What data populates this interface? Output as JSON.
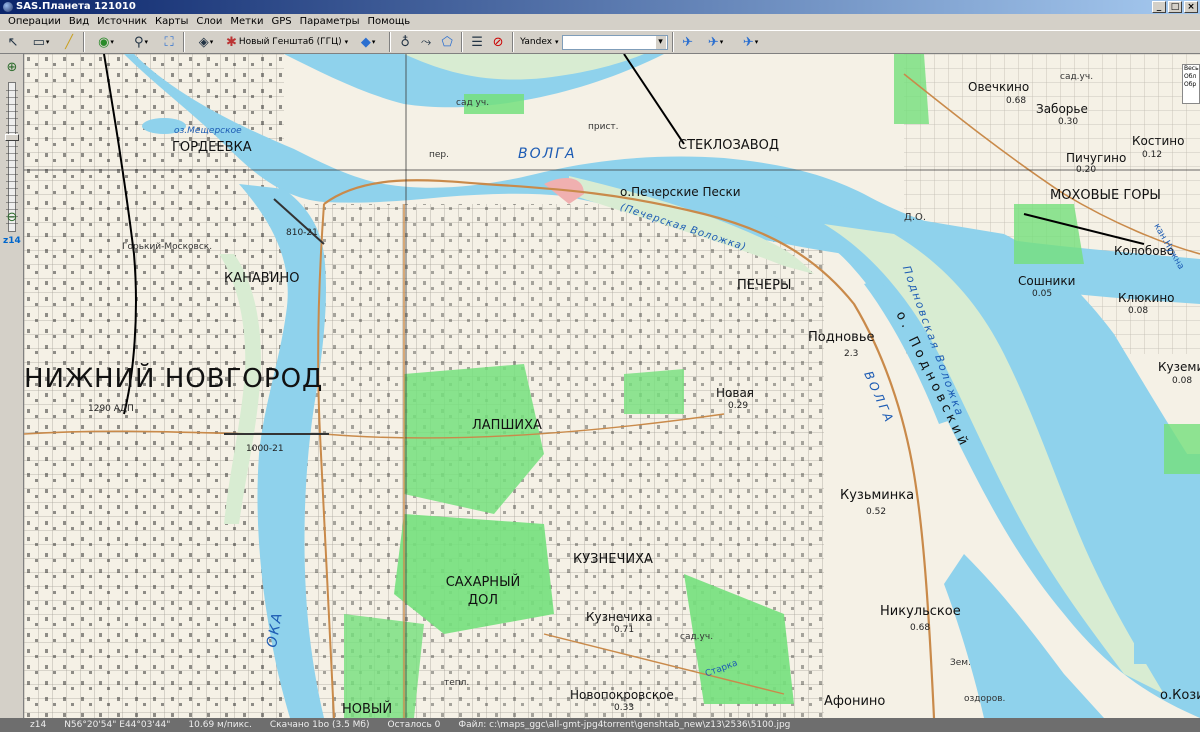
{
  "window": {
    "title": "SAS.Планета 121010"
  },
  "menu": [
    "Операции",
    "Вид",
    "Источник",
    "Карты",
    "Слои",
    "Метки",
    "GPS",
    "Параметры",
    "Помощь"
  ],
  "toolbar": {
    "map_source_label": "Новый Генштаб (ГГЦ)",
    "search_provider_label": "Yandex",
    "search_value": ""
  },
  "zoom": {
    "level_label": "z14"
  },
  "map": {
    "city_label": "НИЖНИЙ НОВГОРОД",
    "districts": [
      {
        "name": "ГОРДЕЕВКА"
      },
      {
        "name": "КАНАВИНО"
      },
      {
        "name": "ПЕЧЕРЫ"
      },
      {
        "name": "ЛАПШИХА"
      },
      {
        "name": "КУЗНЕЧИХА"
      },
      {
        "name": "САХАРНЫЙ ДОЛ"
      },
      {
        "name": "НОВЫЙ"
      },
      {
        "name": "СТЕКЛОЗАВОД"
      },
      {
        "name": "МОХОВЫЕ ГОРЫ"
      }
    ],
    "villages": [
      {
        "name": "Овечкино",
        "value": "0.68"
      },
      {
        "name": "Заборье",
        "value": "0.30"
      },
      {
        "name": "Костино",
        "value": "0.12"
      },
      {
        "name": "Пичугино",
        "value": "0.20"
      },
      {
        "name": "Колобово",
        "value": ""
      },
      {
        "name": "Сошники",
        "value": "0.05"
      },
      {
        "name": "Клюкино",
        "value": "0.08"
      },
      {
        "name": "Подновье",
        "value": "2.3"
      },
      {
        "name": "Новая",
        "value": "0.29"
      },
      {
        "name": "Кузьминка",
        "value": "0.52"
      },
      {
        "name": "Никульское",
        "value": "0.68"
      },
      {
        "name": "Кузнечиха",
        "value": "0.71"
      },
      {
        "name": "Новопокровское",
        "value": "0.33"
      },
      {
        "name": "Афонино",
        "value": ""
      },
      {
        "name": "Куземи",
        "value": "0.08"
      },
      {
        "name": "о.Кози",
        "value": ""
      }
    ],
    "rivers": [
      "ВОЛГА",
      "ВОЛГА",
      "ОКА"
    ],
    "islands": {
      "pecherskie": "о.Печерские Пески",
      "pecherskaya_volozhka": "(Печерская Воложка)",
      "podnovskaya_volozhka": "Подновская Воложка",
      "podnovskiy": "о. Подновский"
    },
    "annotations": {
      "lake": "оз.Мещерское",
      "bridge_1": "810-21",
      "bridge_2": "1000-21",
      "bridge_3": "1290 АДП",
      "kanavino_bridge": "Горький-Московск.",
      "ferry": "пер.",
      "pier": "прист.",
      "garden_1": "сад уч.",
      "garden_2": "сад.уч.",
      "garden_3": "сад.уч.",
      "kan_nuzhna": "кан.Нужна",
      "do_label": "Д.О.",
      "zem": "Зем.",
      "ozdor": "оздоров.",
      "tepl": "тепл.",
      "starka": "Старка"
    },
    "scale_box_lines": [
      "Весь",
      "Обл",
      "Обр"
    ]
  },
  "status": {
    "zoom": "z14",
    "coords": "N56°20'54\" E44°03'44\"",
    "scale": "10.69 м/пикс.",
    "downloaded": "Скачано 1bo (3.5 Мб)",
    "remaining": "Осталось 0",
    "file": "Файл: c:\\maps_ggc\\all-gmt-jpg4torrent\\genshtab_new\\z13\\2536\\5100.jpg"
  },
  "colors": {
    "water": "#8ccfe8",
    "forest": "#74e07c",
    "sand": "#d8ecd2",
    "road": "#c98a4a",
    "titlebar": "#0a246a"
  }
}
